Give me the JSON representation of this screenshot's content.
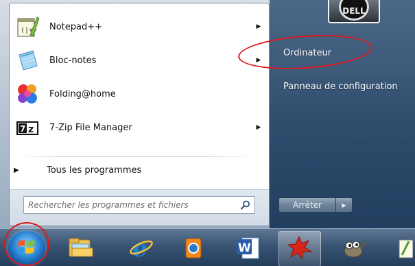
{
  "programs": [
    {
      "label": "Notepad++",
      "icon": "notepad-plus-plus-icon",
      "has_submenu": true
    },
    {
      "label": "Bloc-notes",
      "icon": "notepad-icon",
      "has_submenu": true
    },
    {
      "label": "Folding@home",
      "icon": "folding-at-home-icon",
      "has_submenu": false
    },
    {
      "label": "7-Zip File Manager",
      "icon": "seven-zip-icon",
      "has_submenu": true
    }
  ],
  "all_programs_label": "Tous les programmes",
  "search": {
    "placeholder": "Rechercher les programmes et fichiers"
  },
  "right_pane": {
    "items": [
      {
        "label": "Ordinateur"
      },
      {
        "label": "Panneau de configuration"
      }
    ]
  },
  "shutdown": {
    "label": "Arrêter"
  },
  "user_picture_text": "DELL",
  "taskbar": {
    "items": [
      {
        "icon": "start-orb-icon"
      },
      {
        "icon": "file-explorer-icon"
      },
      {
        "icon": "internet-explorer-icon"
      },
      {
        "icon": "media-player-icon"
      },
      {
        "icon": "word-icon"
      },
      {
        "icon": "folding-at-home-icon"
      },
      {
        "icon": "gimp-icon"
      }
    ]
  },
  "colors": {
    "annotation": "#e01818",
    "right_pane": "#2c4a6d",
    "taskbar": "#2c4a6d"
  }
}
